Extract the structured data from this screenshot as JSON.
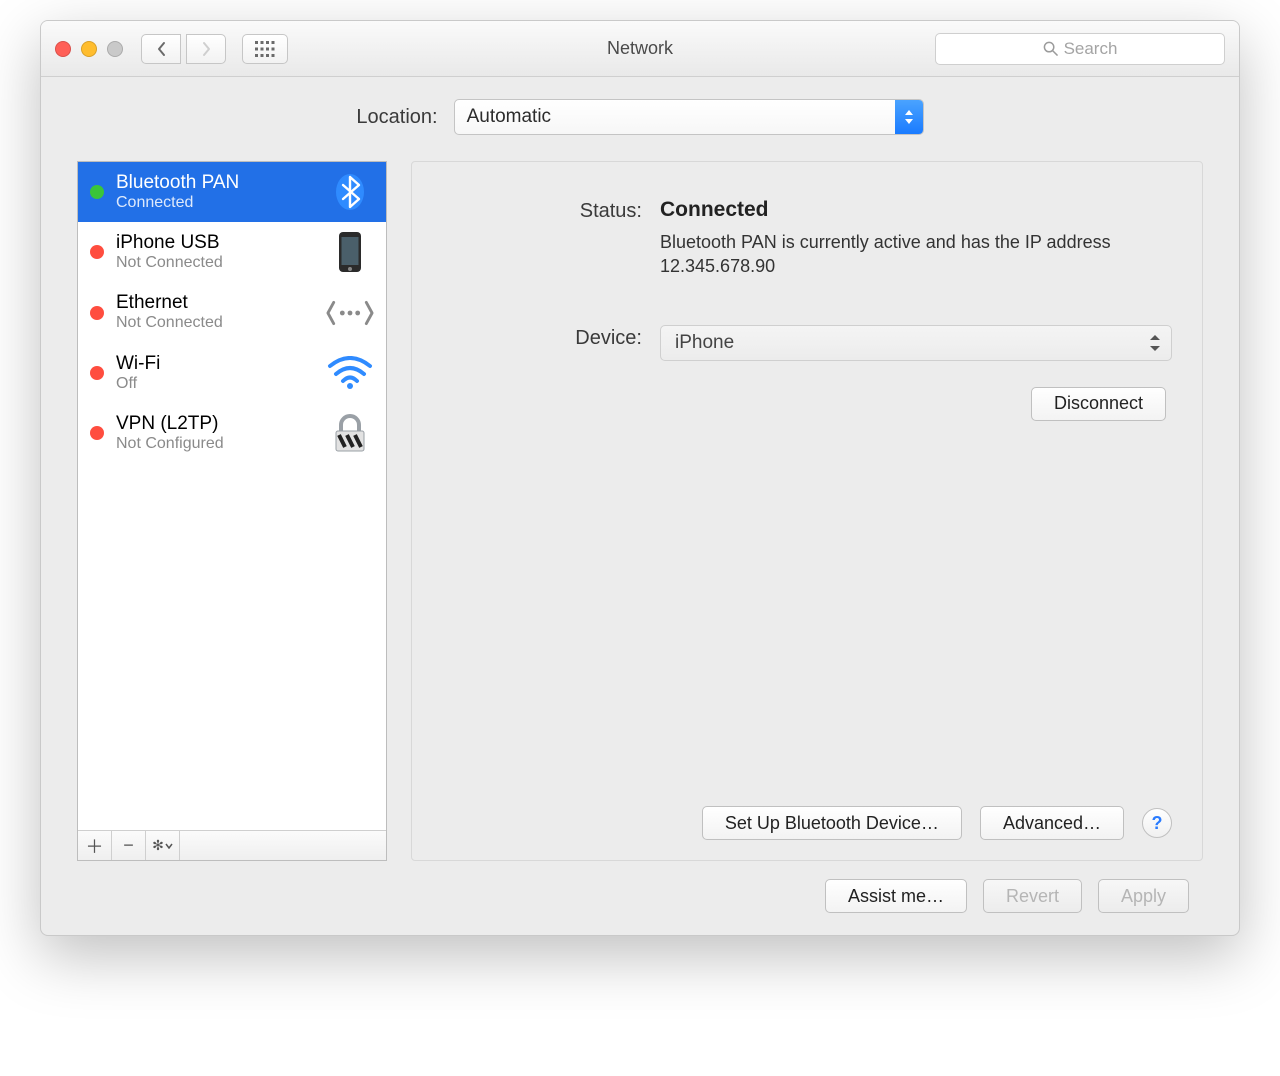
{
  "window": {
    "title": "Network"
  },
  "search": {
    "placeholder": "Search"
  },
  "location": {
    "label": "Location:",
    "value": "Automatic"
  },
  "sidebar": {
    "items": [
      {
        "name": "Bluetooth PAN",
        "sub": "Connected",
        "dot": "green",
        "icon": "bluetooth",
        "selected": true
      },
      {
        "name": "iPhone USB",
        "sub": "Not Connected",
        "dot": "red",
        "icon": "iphone",
        "selected": false
      },
      {
        "name": "Ethernet",
        "sub": "Not Connected",
        "dot": "red",
        "icon": "ethernet",
        "selected": false
      },
      {
        "name": "Wi-Fi",
        "sub": "Off",
        "dot": "red",
        "icon": "wifi",
        "selected": false
      },
      {
        "name": "VPN (L2TP)",
        "sub": "Not Configured",
        "dot": "red",
        "icon": "vpn",
        "selected": false
      }
    ]
  },
  "detail": {
    "status_label": "Status:",
    "status_value": "Connected",
    "status_desc": "Bluetooth PAN is currently active and has the IP address 12.345.678.90",
    "device_label": "Device:",
    "device_value": "iPhone",
    "disconnect": "Disconnect",
    "setup_bt": "Set Up Bluetooth Device…",
    "advanced": "Advanced…"
  },
  "footer": {
    "assist": "Assist me…",
    "revert": "Revert",
    "apply": "Apply"
  }
}
